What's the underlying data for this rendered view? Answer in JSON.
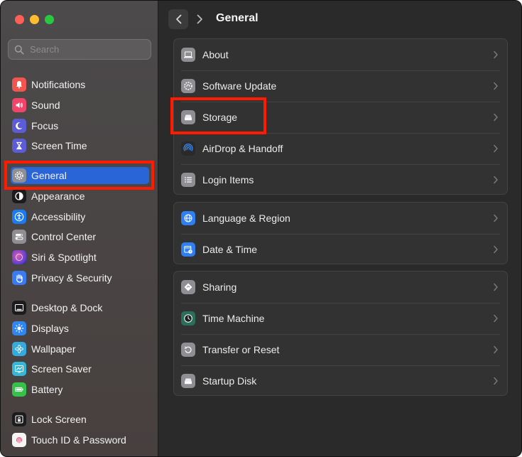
{
  "window": {
    "title": "General"
  },
  "search": {
    "placeholder": "Search"
  },
  "sidebar": {
    "items": [
      {
        "label": "Notifications",
        "icon": "bell-icon",
        "color": "#f2554f"
      },
      {
        "label": "Sound",
        "icon": "speaker-icon",
        "color": "#f0446a"
      },
      {
        "label": "Focus",
        "icon": "moon-icon",
        "color": "#5b5cd6"
      },
      {
        "label": "Screen Time",
        "icon": "hourglass-icon",
        "color": "#5b5cd6"
      },
      {
        "label": "General",
        "icon": "gear-icon",
        "color": "#8e8e93",
        "selected": true
      },
      {
        "label": "Appearance",
        "icon": "appearance-icon",
        "color": "#1c1c1e"
      },
      {
        "label": "Accessibility",
        "icon": "accessibility-icon",
        "color": "#1a7cf2"
      },
      {
        "label": "Control Center",
        "icon": "control-center-icon",
        "color": "#8e8e93"
      },
      {
        "label": "Siri & Spotlight",
        "icon": "siri-icon",
        "color": "#b548c6"
      },
      {
        "label": "Privacy & Security",
        "icon": "hand-icon",
        "color": "#3a7bf2"
      },
      {
        "label": "Desktop & Dock",
        "icon": "dock-icon",
        "color": "#1c1c1e"
      },
      {
        "label": "Displays",
        "icon": "sun-icon",
        "color": "#2f86f2"
      },
      {
        "label": "Wallpaper",
        "icon": "flower-icon",
        "color": "#35aadc"
      },
      {
        "label": "Screen Saver",
        "icon": "screensaver-icon",
        "color": "#35b8d8"
      },
      {
        "label": "Battery",
        "icon": "battery-icon",
        "color": "#36c24a"
      },
      {
        "label": "Lock Screen",
        "icon": "lock-icon",
        "color": "#1c1c1e"
      },
      {
        "label": "Touch ID & Password",
        "icon": "fingerprint-icon",
        "color": "#f5f5f5"
      }
    ]
  },
  "main": {
    "groups": [
      {
        "rows": [
          {
            "label": "About",
            "icon": "laptop-icon"
          },
          {
            "label": "Software Update",
            "icon": "gear-update-icon"
          },
          {
            "label": "Storage",
            "icon": "drive-icon"
          },
          {
            "label": "AirDrop & Handoff",
            "icon": "airdrop-icon"
          },
          {
            "label": "Login Items",
            "icon": "list-icon"
          }
        ]
      },
      {
        "rows": [
          {
            "label": "Language & Region",
            "icon": "globe-icon"
          },
          {
            "label": "Date & Time",
            "icon": "calendar-clock-icon"
          }
        ]
      },
      {
        "rows": [
          {
            "label": "Sharing",
            "icon": "sharing-icon"
          },
          {
            "label": "Time Machine",
            "icon": "time-machine-icon"
          },
          {
            "label": "Transfer or Reset",
            "icon": "reset-icon"
          },
          {
            "label": "Startup Disk",
            "icon": "startup-disk-icon"
          }
        ]
      }
    ]
  },
  "colors": {
    "selection": "#2a65d8",
    "highlight_box": "#ff1a00"
  }
}
